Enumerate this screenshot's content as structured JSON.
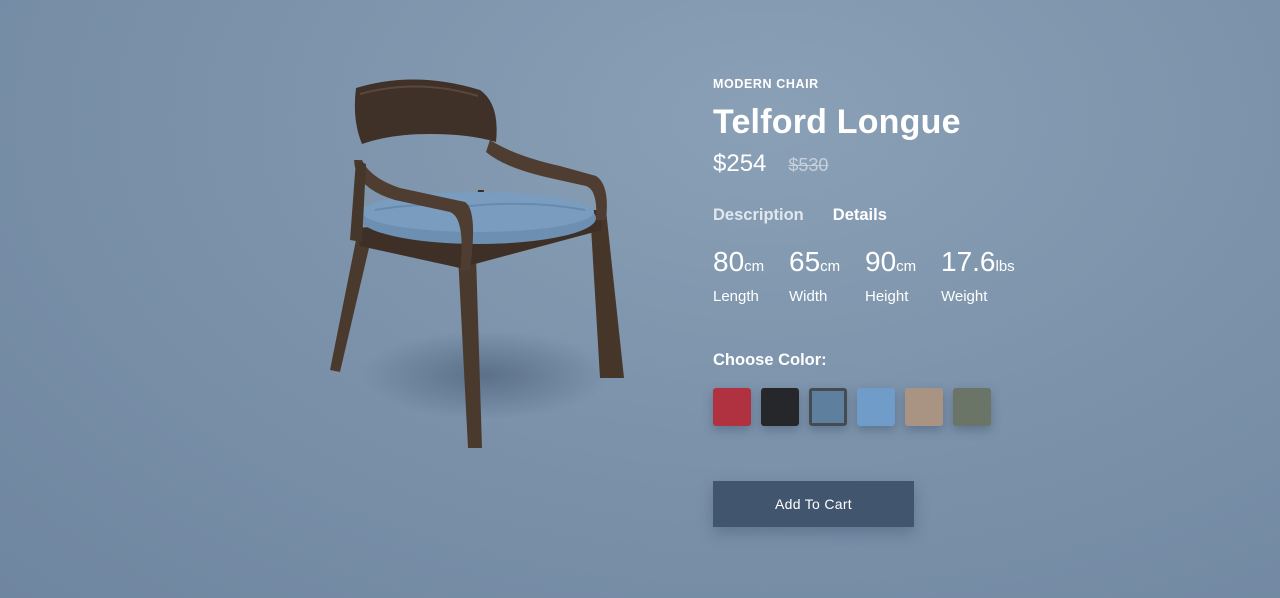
{
  "product": {
    "category": "MODERN CHAIR",
    "name": "Telford Longue",
    "price": "$254",
    "old_price": "$530"
  },
  "tabs": [
    {
      "label": "Description"
    },
    {
      "label": "Details"
    }
  ],
  "specs": [
    {
      "value": "80",
      "unit": "cm",
      "label": "Length"
    },
    {
      "value": "65",
      "unit": "cm",
      "label": "Width"
    },
    {
      "value": "90",
      "unit": "cm",
      "label": "Height"
    },
    {
      "value": "17.6",
      "unit": "lbs",
      "label": "Weight"
    }
  ],
  "color_picker": {
    "label": "Choose Color:",
    "swatches": [
      {
        "color": "#b0313f"
      },
      {
        "color": "#26272a"
      },
      {
        "color": "#5f7f9e",
        "selected": true
      },
      {
        "color": "#6f9cc8"
      },
      {
        "color": "#a99484"
      },
      {
        "color": "#6b7567"
      }
    ]
  },
  "cart": {
    "button_label": "Add To Cart"
  },
  "colors": {
    "wood": "#4a3a2e",
    "seat": "#6d8fb2",
    "button": "#42556f"
  }
}
